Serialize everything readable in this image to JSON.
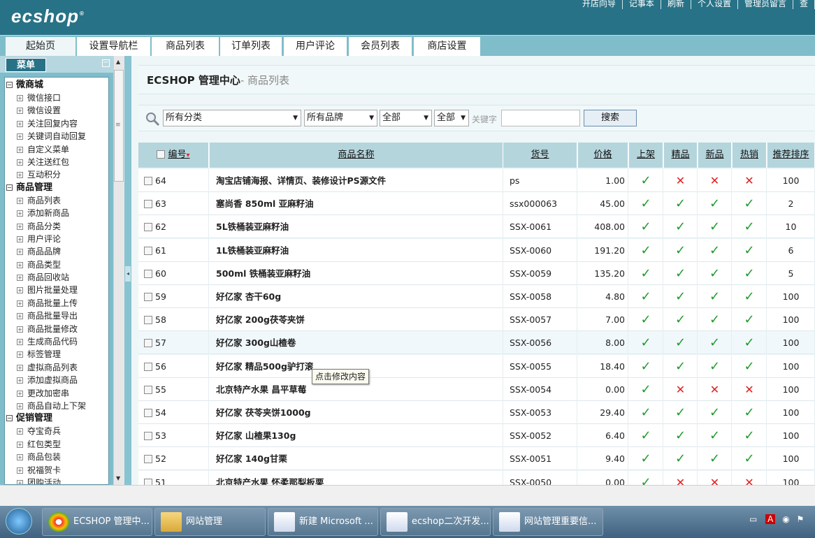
{
  "app": {
    "logo": "ecshop",
    "logo_mark": "®"
  },
  "top_links": [
    "开店向导",
    "记事本",
    "刷新",
    "个人设置",
    "管理员留言",
    "查"
  ],
  "tabs": [
    "起始页",
    "设置导航栏",
    "商品列表",
    "订单列表",
    "用户评论",
    "会员列表",
    "商店设置"
  ],
  "menu": {
    "label": "菜单",
    "collapse": "−",
    "groups": [
      {
        "title": "微商城",
        "items": [
          "微信接口",
          "微信设置",
          "关注回复内容",
          "关键词自动回复",
          "自定义菜单",
          "关注送红包",
          "互动积分"
        ]
      },
      {
        "title": "商品管理",
        "items": [
          "商品列表",
          "添加新商品",
          "商品分类",
          "用户评论",
          "商品品牌",
          "商品类型",
          "商品回收站",
          "图片批量处理",
          "商品批量上传",
          "商品批量导出",
          "商品批量修改",
          "生成商品代码",
          "标签管理",
          "虚拟商品列表",
          "添加虚拟商品",
          "更改加密串",
          "商品自动上下架"
        ]
      },
      {
        "title": "促销管理",
        "items": [
          "夺宝奇兵",
          "红包类型",
          "商品包装",
          "祝福贺卡",
          "团购活动"
        ]
      }
    ]
  },
  "page": {
    "title": "ECSHOP 管理中心",
    "subtitle": "- 商品列表"
  },
  "filters": {
    "category": "所有分类",
    "brand": "所有品牌",
    "type": "全部",
    "status": "全部",
    "keyword_label": "关键字",
    "keyword_value": "",
    "search_button": "搜索"
  },
  "table": {
    "columns": [
      "编号",
      "商品名称",
      "货号",
      "价格",
      "上架",
      "精品",
      "新品",
      "热销",
      "推荐排序"
    ],
    "sort_indicator": "▾",
    "rows": [
      {
        "id": "64",
        "name": "淘宝店铺海报、详情页、装修设计PS源文件",
        "sn": "ps",
        "price": "1.00",
        "on_sale": true,
        "best": false,
        "new": false,
        "hot": false,
        "order": "100"
      },
      {
        "id": "63",
        "name": "塞尚香  850ml 亚麻籽油",
        "sn": "ssx000063",
        "price": "45.00",
        "on_sale": true,
        "best": true,
        "new": true,
        "hot": true,
        "order": "2"
      },
      {
        "id": "62",
        "name": "5L铁桶装亚麻籽油",
        "sn": "SSX-0061",
        "price": "408.00",
        "on_sale": true,
        "best": true,
        "new": true,
        "hot": true,
        "order": "10"
      },
      {
        "id": "61",
        "name": "1L铁桶装亚麻籽油",
        "sn": "SSX-0060",
        "price": "191.20",
        "on_sale": true,
        "best": true,
        "new": true,
        "hot": true,
        "order": "6"
      },
      {
        "id": "60",
        "name": "500ml 铁桶装亚麻籽油",
        "sn": "SSX-0059",
        "price": "135.20",
        "on_sale": true,
        "best": true,
        "new": true,
        "hot": true,
        "order": "5"
      },
      {
        "id": "59",
        "name": "好亿家  杏干60g",
        "sn": "SSX-0058",
        "price": "4.80",
        "on_sale": true,
        "best": true,
        "new": true,
        "hot": true,
        "order": "100"
      },
      {
        "id": "58",
        "name": "好亿家  200g茯苓夹饼",
        "sn": "SSX-0057",
        "price": "7.00",
        "on_sale": true,
        "best": true,
        "new": true,
        "hot": true,
        "order": "100"
      },
      {
        "id": "57",
        "name": "好亿家  300g山楂卷",
        "sn": "SSX-0056",
        "price": "8.00",
        "on_sale": true,
        "best": true,
        "new": true,
        "hot": true,
        "order": "100"
      },
      {
        "id": "56",
        "name": "好亿家  精品500g驴打滚",
        "sn": "SSX-0055",
        "price": "18.40",
        "on_sale": true,
        "best": true,
        "new": true,
        "hot": true,
        "order": "100"
      },
      {
        "id": "55",
        "name": "北京特产水果  昌平草莓",
        "sn": "SSX-0054",
        "price": "0.00",
        "on_sale": true,
        "best": false,
        "new": false,
        "hot": false,
        "order": "100"
      },
      {
        "id": "54",
        "name": "好亿家  茯苓夹饼1000g",
        "sn": "SSX-0053",
        "price": "29.40",
        "on_sale": true,
        "best": true,
        "new": true,
        "hot": true,
        "order": "100"
      },
      {
        "id": "53",
        "name": "好亿家  山楂果130g",
        "sn": "SSX-0052",
        "price": "6.40",
        "on_sale": true,
        "best": true,
        "new": true,
        "hot": true,
        "order": "100"
      },
      {
        "id": "52",
        "name": "好亿家  140g甘栗",
        "sn": "SSX-0051",
        "price": "9.40",
        "on_sale": true,
        "best": true,
        "new": true,
        "hot": true,
        "order": "100"
      },
      {
        "id": "51",
        "name": "北京特产水果  怀柔那梨板栗",
        "sn": "SSX-0050",
        "price": "0.00",
        "on_sale": true,
        "best": false,
        "new": false,
        "hot": false,
        "order": "100"
      }
    ]
  },
  "tooltip": "点击修改内容",
  "taskbar": {
    "items": [
      "ECSHOP 管理中...",
      "网站管理",
      "新建 Microsoft ...",
      "ecshop二次开发...",
      "网站管理重要信..."
    ]
  },
  "colors": {
    "header": "#287287",
    "tabbar": "#80bdcb",
    "check": "#1e9a2c",
    "cross": "#e02020"
  }
}
